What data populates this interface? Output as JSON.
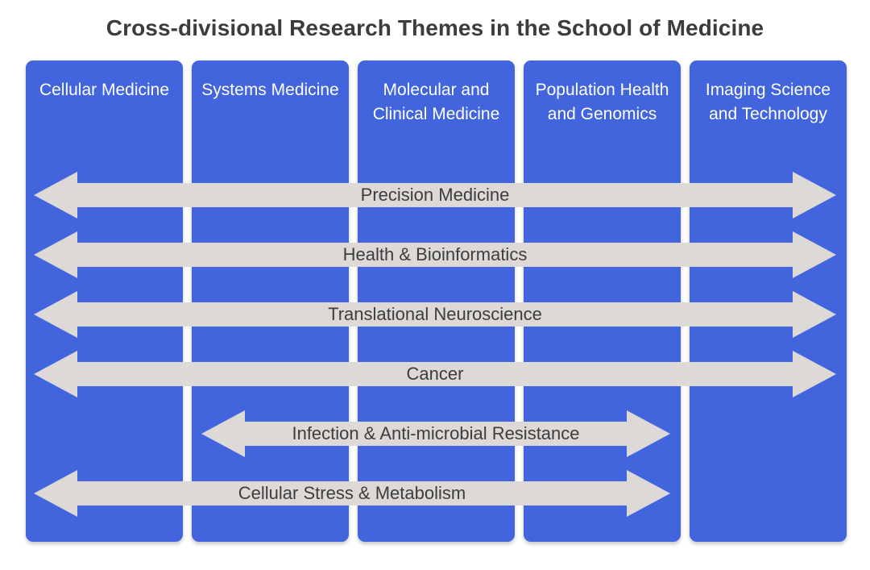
{
  "title": "Cross-divisional Research Themes in the School of Medicine",
  "colors": {
    "division_blue": "#4265DE",
    "arrow_gray": "#DCD9D6",
    "title_text": "#3C3C3C",
    "arrow_text": "#3D3D3D",
    "column_text": "#FFFFFF",
    "background": "#FFFFFF"
  },
  "divisions": [
    {
      "label": "Cellular Medicine"
    },
    {
      "label": "Systems Medicine"
    },
    {
      "label": "Molecular and Clinical Medicine"
    },
    {
      "label": "Population Health and Genomics"
    },
    {
      "label": "Imaging Science and Technology"
    }
  ],
  "themes": [
    {
      "label": "Precision Medicine",
      "spans_divisions": [
        "Cellular Medicine",
        "Systems Medicine",
        "Molecular and Clinical Medicine",
        "Population Health and Genomics",
        "Imaging Science and Technology"
      ],
      "direction": "bidirectional"
    },
    {
      "label": "Health & Bioinformatics",
      "spans_divisions": [
        "Cellular Medicine",
        "Systems Medicine",
        "Molecular and Clinical Medicine",
        "Population Health and Genomics",
        "Imaging Science and Technology"
      ],
      "direction": "bidirectional"
    },
    {
      "label": "Translational Neuroscience",
      "spans_divisions": [
        "Cellular Medicine",
        "Systems Medicine",
        "Molecular and Clinical Medicine",
        "Population Health and Genomics",
        "Imaging Science and Technology"
      ],
      "direction": "bidirectional"
    },
    {
      "label": "Cancer",
      "spans_divisions": [
        "Cellular Medicine",
        "Systems Medicine",
        "Molecular and Clinical Medicine",
        "Population Health and Genomics",
        "Imaging Science and Technology"
      ],
      "direction": "bidirectional"
    },
    {
      "label": "Infection & Anti-microbial Resistance",
      "spans_divisions": [
        "Systems Medicine",
        "Molecular and Clinical Medicine",
        "Population Health and Genomics"
      ],
      "direction": "bidirectional"
    },
    {
      "label": "Cellular Stress & Metabolism",
      "spans_divisions": [
        "Cellular Medicine",
        "Systems Medicine",
        "Molecular and Clinical Medicine",
        "Population Health and Genomics"
      ],
      "direction": "bidirectional"
    }
  ]
}
